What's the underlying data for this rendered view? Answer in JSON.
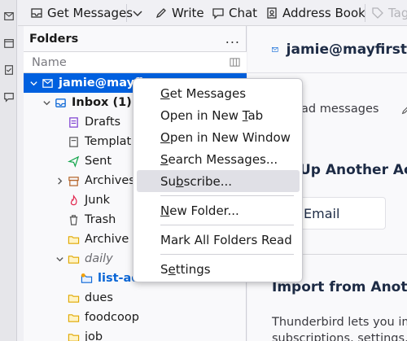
{
  "toolbar": {
    "get_messages": "Get Messages",
    "write": "Write",
    "chat": "Chat",
    "address_book": "Address Book",
    "tag": "Tag"
  },
  "folder_pane": {
    "title": "Folders",
    "more": "...",
    "column_name": "Name",
    "account": "jamie@mayfi",
    "inbox": "Inbox (1)",
    "folders": [
      "Drafts",
      "Templat",
      "Sent",
      "Archives",
      "Junk",
      "Trash",
      "Archive"
    ],
    "daily": "daily",
    "list_ad": "list-ad",
    "more_folders": [
      "dues",
      "foodcoop",
      "job"
    ]
  },
  "content": {
    "account_title": "jamie@mayfirst",
    "read_messages": "ad messages",
    "setup_title": "Up Another Acc",
    "email_card": "Email",
    "import_title": "Import from Anothe",
    "import_text_1": "Thunderbird lets you im",
    "import_text_2": "subscriptions, settings, a"
  },
  "context_menu": {
    "items": [
      {
        "label": "Get Messages",
        "mnemonic_index": 0
      },
      {
        "label": "Open in New Tab",
        "mnemonic_index": 12
      },
      {
        "label": "Open in New Window",
        "mnemonic_index": 0
      },
      {
        "label": "Search Messages...",
        "mnemonic_index": 0
      },
      {
        "label": "Subscribe...",
        "mnemonic_index": 2
      },
      {
        "label": "New Folder...",
        "mnemonic_index": 0
      },
      {
        "label": "Mark All Folders Read",
        "mnemonic_index": -1
      },
      {
        "label": "Settings",
        "mnemonic_index": 1
      }
    ],
    "hovered": "Subscribe..."
  },
  "colors": {
    "selection": "#0060df",
    "menu_hover": "#e0e0e6",
    "heading": "#1d2b45"
  }
}
